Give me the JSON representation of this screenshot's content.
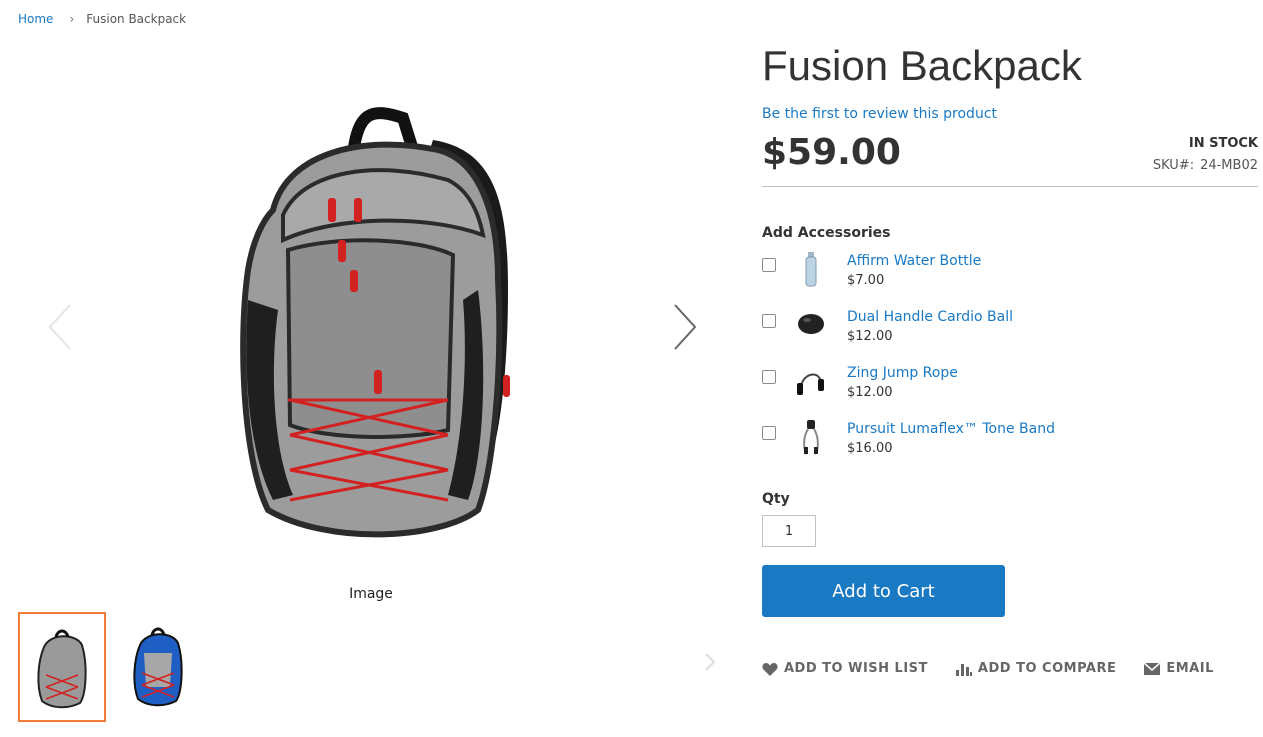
{
  "breadcrumb": {
    "home": "Home",
    "separator": "›",
    "current": "Fusion Backpack"
  },
  "gallery": {
    "caption": "Image",
    "thumbnails": [
      {
        "name": "gray-backpack-thumb",
        "active": true
      },
      {
        "name": "blue-backpack-thumb",
        "active": false
      }
    ]
  },
  "product": {
    "title": "Fusion Backpack",
    "review_link": "Be the first to review this product",
    "price": "$59.00",
    "stock": "IN STOCK",
    "sku_label": "SKU#:",
    "sku": "24-MB02"
  },
  "accessories": {
    "heading": "Add Accessories",
    "items": [
      {
        "name": "Affirm Water Bottle",
        "price": "$7.00",
        "icon": "water-bottle-icon"
      },
      {
        "name": "Dual Handle Cardio Ball",
        "price": "$12.00",
        "icon": "cardio-ball-icon"
      },
      {
        "name": "Zing Jump Rope",
        "price": "$12.00",
        "icon": "jump-rope-icon"
      },
      {
        "name": "Pursuit Lumaflex™ Tone Band",
        "price": "$16.00",
        "icon": "tone-band-icon"
      }
    ]
  },
  "purchase": {
    "qty_label": "Qty",
    "qty_value": "1",
    "add_to_cart": "Add to Cart"
  },
  "actions": {
    "wishlist": "ADD TO WISH LIST",
    "compare": "ADD TO COMPARE",
    "email": "EMAIL"
  },
  "colors": {
    "link": "#1979c3",
    "button": "#1979c3",
    "active_thumb_border": "#f07d36",
    "text": "#333333"
  }
}
